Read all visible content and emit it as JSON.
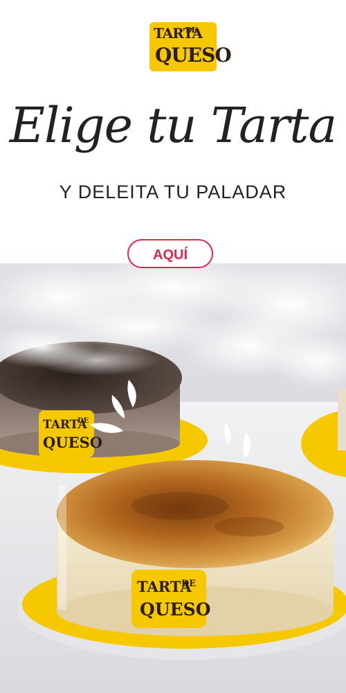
{
  "brand": {
    "logo_line1": "TARTA",
    "logo_line1_small": "DE",
    "logo_line2": "QUESO"
  },
  "headline": "Elige tu Tarta",
  "subheadline": "Y DELEITA TU PALADAR",
  "cta": {
    "label": "AQUÍ"
  },
  "colors": {
    "brand_yellow": "#f5c800",
    "accent_red": "#e3264a",
    "text_dark": "#222222"
  }
}
